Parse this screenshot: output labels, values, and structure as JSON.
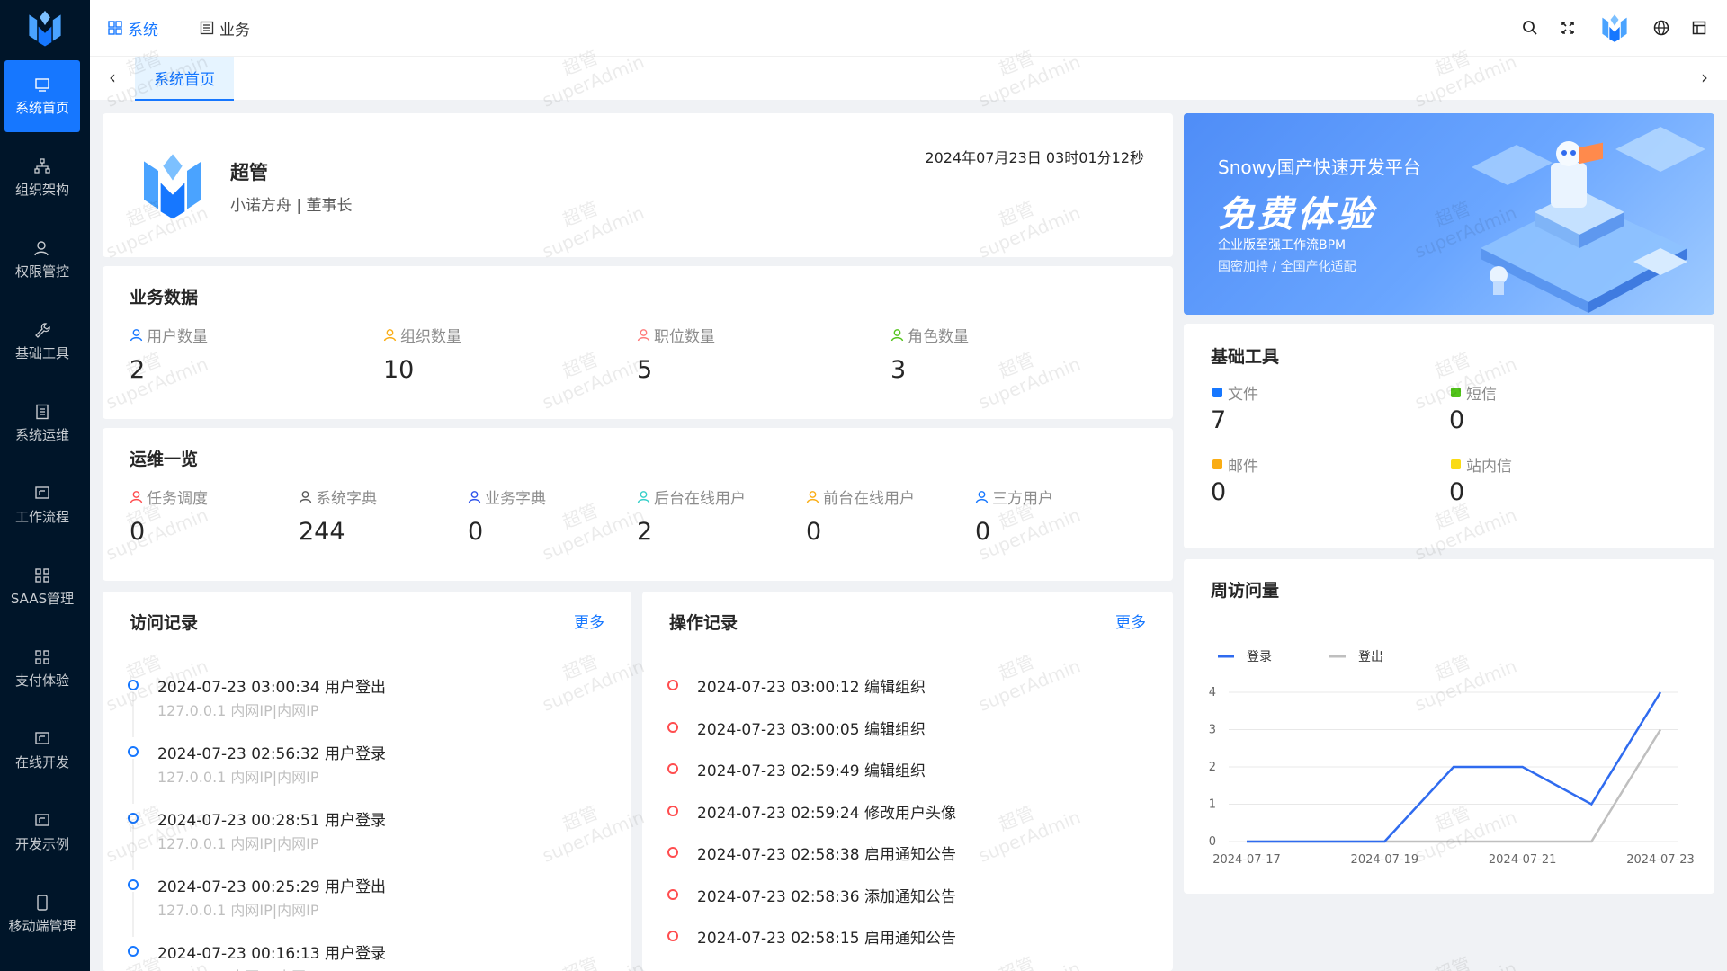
{
  "nav": {
    "items": [
      {
        "label": "系统首页",
        "icon": "monitor-icon"
      },
      {
        "label": "组织架构",
        "icon": "org-tree-icon"
      },
      {
        "label": "权限管控",
        "icon": "user-lock-icon"
      },
      {
        "label": "基础工具",
        "icon": "wrench-icon"
      },
      {
        "label": "系统运维",
        "icon": "document-icon"
      },
      {
        "label": "工作流程",
        "icon": "workflow-icon"
      },
      {
        "label": "SAAS管理",
        "icon": "grid-icon"
      },
      {
        "label": "支付体验",
        "icon": "grid-icon"
      },
      {
        "label": "在线开发",
        "icon": "code-icon"
      },
      {
        "label": "开发示例",
        "icon": "code-icon"
      },
      {
        "label": "移动端管理",
        "icon": "mobile-icon"
      }
    ]
  },
  "topbar": {
    "menus": [
      {
        "label": "系统",
        "icon": "grid-icon"
      },
      {
        "label": "业务",
        "icon": "list-icon"
      }
    ]
  },
  "tabs": {
    "active": "系统首页"
  },
  "profile": {
    "name": "超管",
    "subtitle": "小诺方舟 | 董事长",
    "datetime": "2024年07月23日 03时01分12秒"
  },
  "business": {
    "title": "业务数据",
    "stats": [
      {
        "label": "用户数量",
        "value": "2",
        "color": "#1677ff"
      },
      {
        "label": "组织数量",
        "value": "10",
        "color": "#faad14"
      },
      {
        "label": "职位数量",
        "value": "5",
        "color": "#ff7a7a"
      },
      {
        "label": "角色数量",
        "value": "3",
        "color": "#52c41a"
      }
    ]
  },
  "ops": {
    "title": "运维一览",
    "stats": [
      {
        "label": "任务调度",
        "value": "0",
        "color": "#ff4d4f"
      },
      {
        "label": "系统字典",
        "value": "244",
        "color": "#595959"
      },
      {
        "label": "业务字典",
        "value": "0",
        "color": "#2f54eb"
      },
      {
        "label": "后台在线用户",
        "value": "2",
        "color": "#36cfc9"
      },
      {
        "label": "前台在线用户",
        "value": "0",
        "color": "#faad14"
      },
      {
        "label": "三方用户",
        "value": "0",
        "color": "#1677ff"
      }
    ]
  },
  "banner": {
    "line1": "Snowy国产快速开发平台",
    "line2": "免费体验",
    "line3": "企业版至强工作流BPM",
    "line4": "国密加持 / 全国产化适配"
  },
  "tools": {
    "title": "基础工具",
    "items": [
      {
        "label": "文件",
        "value": "7",
        "color": "#1677ff"
      },
      {
        "label": "短信",
        "value": "0",
        "color": "#52c41a"
      },
      {
        "label": "邮件",
        "value": "0",
        "color": "#faad14"
      },
      {
        "label": "站内信",
        "value": "0",
        "color": "#fadb14"
      }
    ]
  },
  "visits": {
    "title": "访问记录",
    "more": "更多",
    "items": [
      {
        "text": "2024-07-23 03:00:34 用户登出",
        "sub": "127.0.0.1 内网IP|内网IP"
      },
      {
        "text": "2024-07-23 02:56:32 用户登录",
        "sub": "127.0.0.1 内网IP|内网IP"
      },
      {
        "text": "2024-07-23 00:28:51 用户登录",
        "sub": "127.0.0.1 内网IP|内网IP"
      },
      {
        "text": "2024-07-23 00:25:29 用户登出",
        "sub": "127.0.0.1 内网IP|内网IP"
      },
      {
        "text": "2024-07-23 00:16:13 用户登录",
        "sub": "127.0.0.1 内网IP|内网IP"
      }
    ]
  },
  "operations": {
    "title": "操作记录",
    "more": "更多",
    "items": [
      {
        "text": "2024-07-23 03:00:12 编辑组织"
      },
      {
        "text": "2024-07-23 03:00:05 编辑组织"
      },
      {
        "text": "2024-07-23 02:59:49 编辑组织"
      },
      {
        "text": "2024-07-23 02:59:24 修改用户头像"
      },
      {
        "text": "2024-07-23 02:58:38 启用通知公告"
      },
      {
        "text": "2024-07-23 02:58:36 添加通知公告"
      },
      {
        "text": "2024-07-23 02:58:15 启用通知公告"
      }
    ]
  },
  "weekly": {
    "title": "周访问量"
  },
  "watermark": {
    "line1": "超管",
    "line2": "superAdmin"
  },
  "chart_data": {
    "type": "line",
    "x": [
      "2024-07-17",
      "2024-07-18",
      "2024-07-19",
      "2024-07-20",
      "2024-07-21",
      "2024-07-22",
      "2024-07-23"
    ],
    "x_ticks": [
      "2024-07-17",
      "2024-07-19",
      "2024-07-21",
      "2024-07-23"
    ],
    "series": [
      {
        "name": "登录",
        "values": [
          0,
          0,
          0,
          2,
          2,
          1,
          4
        ],
        "color": "#2f6bef"
      },
      {
        "name": "登出",
        "values": [
          0,
          0,
          0,
          0,
          0,
          0,
          3
        ],
        "color": "#bfbfbf"
      }
    ],
    "ylim": [
      0,
      4
    ],
    "y_ticks": [
      0,
      1,
      2,
      3,
      4
    ],
    "legend": "top-left",
    "grid": true
  }
}
